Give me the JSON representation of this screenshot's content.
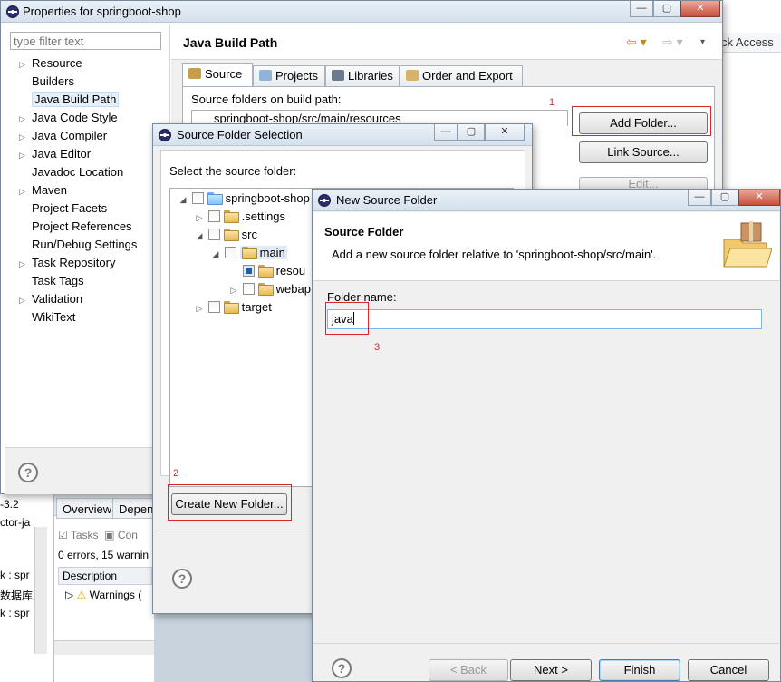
{
  "background": {
    "quick_access": "ck Access",
    "left_lines": [
      "-3.2",
      "ctor-ja",
      "k : spr",
      "数据库力",
      "k : spr"
    ],
    "bottom_tabs": [
      "Overview",
      "Depen"
    ],
    "tasks_tabs": [
      "Tasks",
      "Con"
    ],
    "problems_summary": "0 errors, 15 warnin",
    "description_header": "Description",
    "warnings_row": "Warnings ("
  },
  "properties": {
    "title": "Properties for springboot-shop",
    "filter_placeholder": "type filter text",
    "nav_items": [
      "Resource",
      "Builders",
      "Java Build Path",
      "Java Code Style",
      "Java Compiler",
      "Java Editor",
      "Javadoc Location",
      "Maven",
      "Project Facets",
      "Project References",
      "Run/Debug Settings",
      "Task Repository",
      "Task Tags",
      "Validation",
      "WikiText"
    ],
    "page_title": "Java Build Path",
    "tabs": [
      "Source",
      "Projects",
      "Libraries",
      "Order and Export"
    ],
    "source_label": "Source folders on build path:",
    "source_row": "springboot-shop/src/main/resources",
    "buttons": {
      "add_folder": "Add Folder...",
      "link_source": "Link Source...",
      "edit": "Edit..."
    },
    "help": "?",
    "annotations": {
      "n1": "1"
    }
  },
  "source_folder_selection": {
    "title": "Source Folder Selection",
    "label": "Select the source folder:",
    "tree": {
      "root": "springboot-shop",
      "settings": ".settings",
      "src": "src",
      "main": "main",
      "resources": "resou",
      "webapp": "webap",
      "target": "target"
    },
    "create_button": "Create New Folder...",
    "help": "?",
    "annotations": {
      "n2": "2"
    }
  },
  "new_source_folder": {
    "title": "New Source Folder",
    "heading": "Source Folder",
    "description": "Add a new source folder relative to 'springboot-shop/src/main'.",
    "folder_label": "Folder name:",
    "folder_value": "java",
    "buttons": {
      "back": "< Back",
      "next": "Next >",
      "finish": "Finish",
      "cancel": "Cancel"
    },
    "help": "?",
    "annotations": {
      "n3": "3"
    }
  },
  "window_controls": {
    "minimize": "—",
    "maximize": "▢",
    "close": "✕"
  }
}
